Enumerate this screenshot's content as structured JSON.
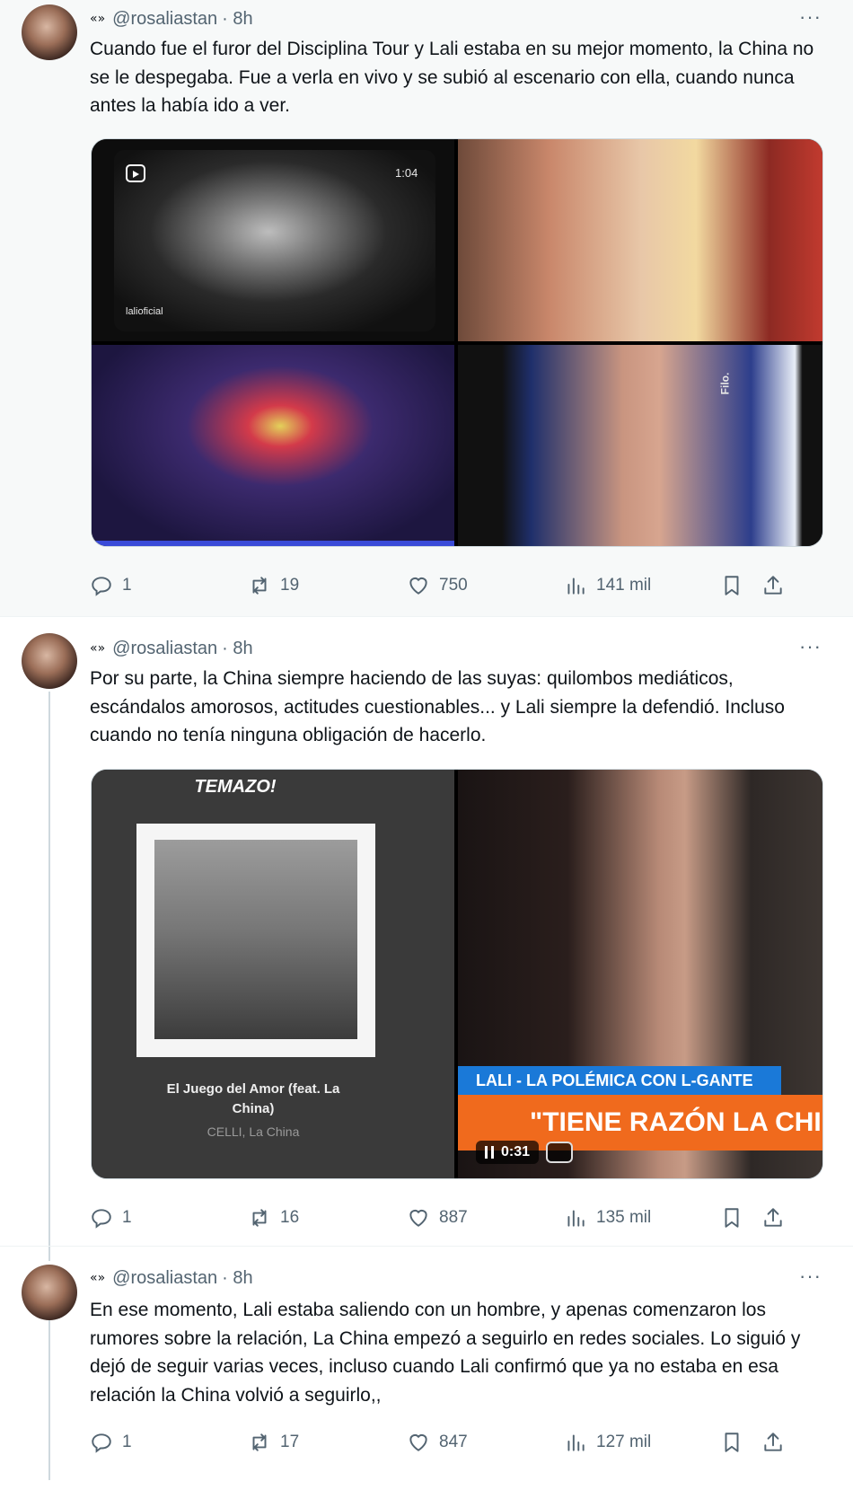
{
  "tweets": [
    {
      "avatar": "user-avatar",
      "handle_symbol": "«»",
      "handle": "@rosaliastan",
      "time": "· 8h",
      "more": "···",
      "text": "Cuando fue el furor del Disciplina Tour y Lali estaba en su mejor momento, la China no se le despegaba. Fue a verla en vivo y se subió al escenario con ella, cuando nunca antes la había ido a ver.",
      "media": {
        "video_duration": "1:04",
        "watermark": "lalioficial",
        "side_text": "Filo."
      },
      "stats": {
        "replies": "1",
        "reposts": "19",
        "likes": "750",
        "views": "141 mil"
      }
    },
    {
      "avatar": "user-avatar",
      "handle_symbol": "«»",
      "handle": "@rosaliastan",
      "time": "· 8h",
      "more": "···",
      "text": "Por su parte, la China siempre haciendo de las suyas: quilombos mediáticos, escándalos amorosos, actitudes cuestionables... y Lali siempre la defendió. Incluso cuando no tenía ninguna obligación de hacerlo.",
      "media": {
        "banner": "TEMAZO!",
        "song_title": "El Juego del Amor (feat. La China)",
        "song_artists": "CELLI, La China",
        "tv_lower_third": "LALI - LA POLÉMICA CON L-GANTE",
        "tv_quote": "\"TIENE RAZÓN LA CHIN",
        "video_time": "0:31"
      },
      "stats": {
        "replies": "1",
        "reposts": "16",
        "likes": "887",
        "views": "135 mil"
      }
    },
    {
      "avatar": "user-avatar",
      "handle_symbol": "«»",
      "handle": "@rosaliastan",
      "time": "· 8h",
      "more": "···",
      "text": "En ese momento, Lali estaba saliendo con un hombre, y apenas comenzaron los rumores sobre la relación, La China empezó a seguirlo en redes sociales. Lo siguió y dejó de seguir varias veces, incluso cuando Lali confirmó que ya no estaba en esa relación la China volvió a seguirlo,,",
      "stats": {
        "replies": "1",
        "reposts": "17",
        "likes": "847",
        "views": "127 mil"
      }
    }
  ],
  "icons": [
    "reply-icon",
    "repost-icon",
    "like-icon",
    "views-icon",
    "bookmark-icon",
    "share-icon"
  ],
  "colors": {
    "muted": "#536471",
    "text": "#0f1419",
    "tv_orange": "#f06a1d",
    "tv_blue": "#1a79d8"
  }
}
